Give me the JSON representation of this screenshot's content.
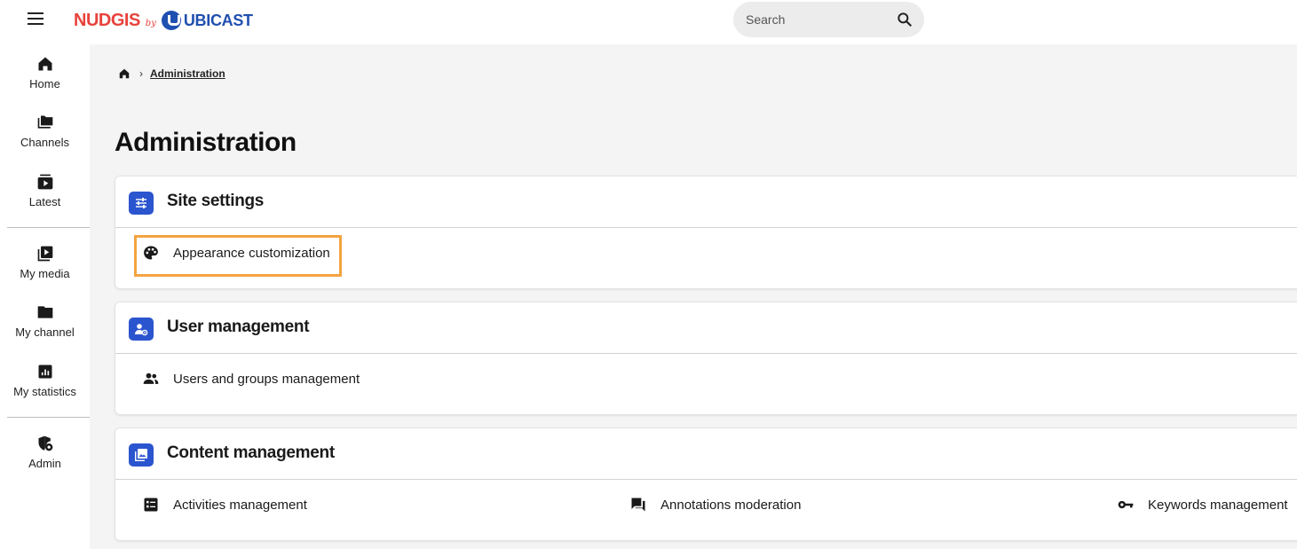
{
  "header": {
    "logo": {
      "brand": "NUDGIS",
      "by": "by",
      "company": "UBICAST"
    },
    "search": {
      "placeholder": "Search"
    }
  },
  "sidebar": {
    "items": [
      {
        "label": "Home",
        "icon": "home-icon"
      },
      {
        "label": "Channels",
        "icon": "folders-icon"
      },
      {
        "label": "Latest",
        "icon": "latest-video-icon"
      },
      {
        "label": "My media",
        "icon": "video-library-icon"
      },
      {
        "label": "My channel",
        "icon": "folder-icon"
      },
      {
        "label": "My statistics",
        "icon": "statistics-icon"
      },
      {
        "label": "Admin",
        "icon": "admin-shield-icon"
      }
    ]
  },
  "breadcrumb": {
    "current": "Administration"
  },
  "page": {
    "title": "Administration"
  },
  "sections": [
    {
      "title": "Site settings",
      "icon": "tune-icon",
      "links": [
        {
          "label": "Appearance customization",
          "icon": "palette-icon",
          "highlighted": true
        }
      ]
    },
    {
      "title": "User management",
      "icon": "user-settings-icon",
      "links": [
        {
          "label": "Users and groups management",
          "icon": "group-icon"
        }
      ]
    },
    {
      "title": "Content management",
      "icon": "photo-library-icon",
      "links": [
        {
          "label": "Activities management",
          "icon": "list-icon"
        },
        {
          "label": "Annotations moderation",
          "icon": "forum-icon"
        },
        {
          "label": "Keywords management",
          "icon": "key-icon"
        }
      ]
    }
  ],
  "colors": {
    "accent": "#2b55cf",
    "brand_red": "#e8423c",
    "brand_blue": "#1f4fb0",
    "highlight": "#f4a340",
    "main_bg": "#f4f4f4"
  }
}
